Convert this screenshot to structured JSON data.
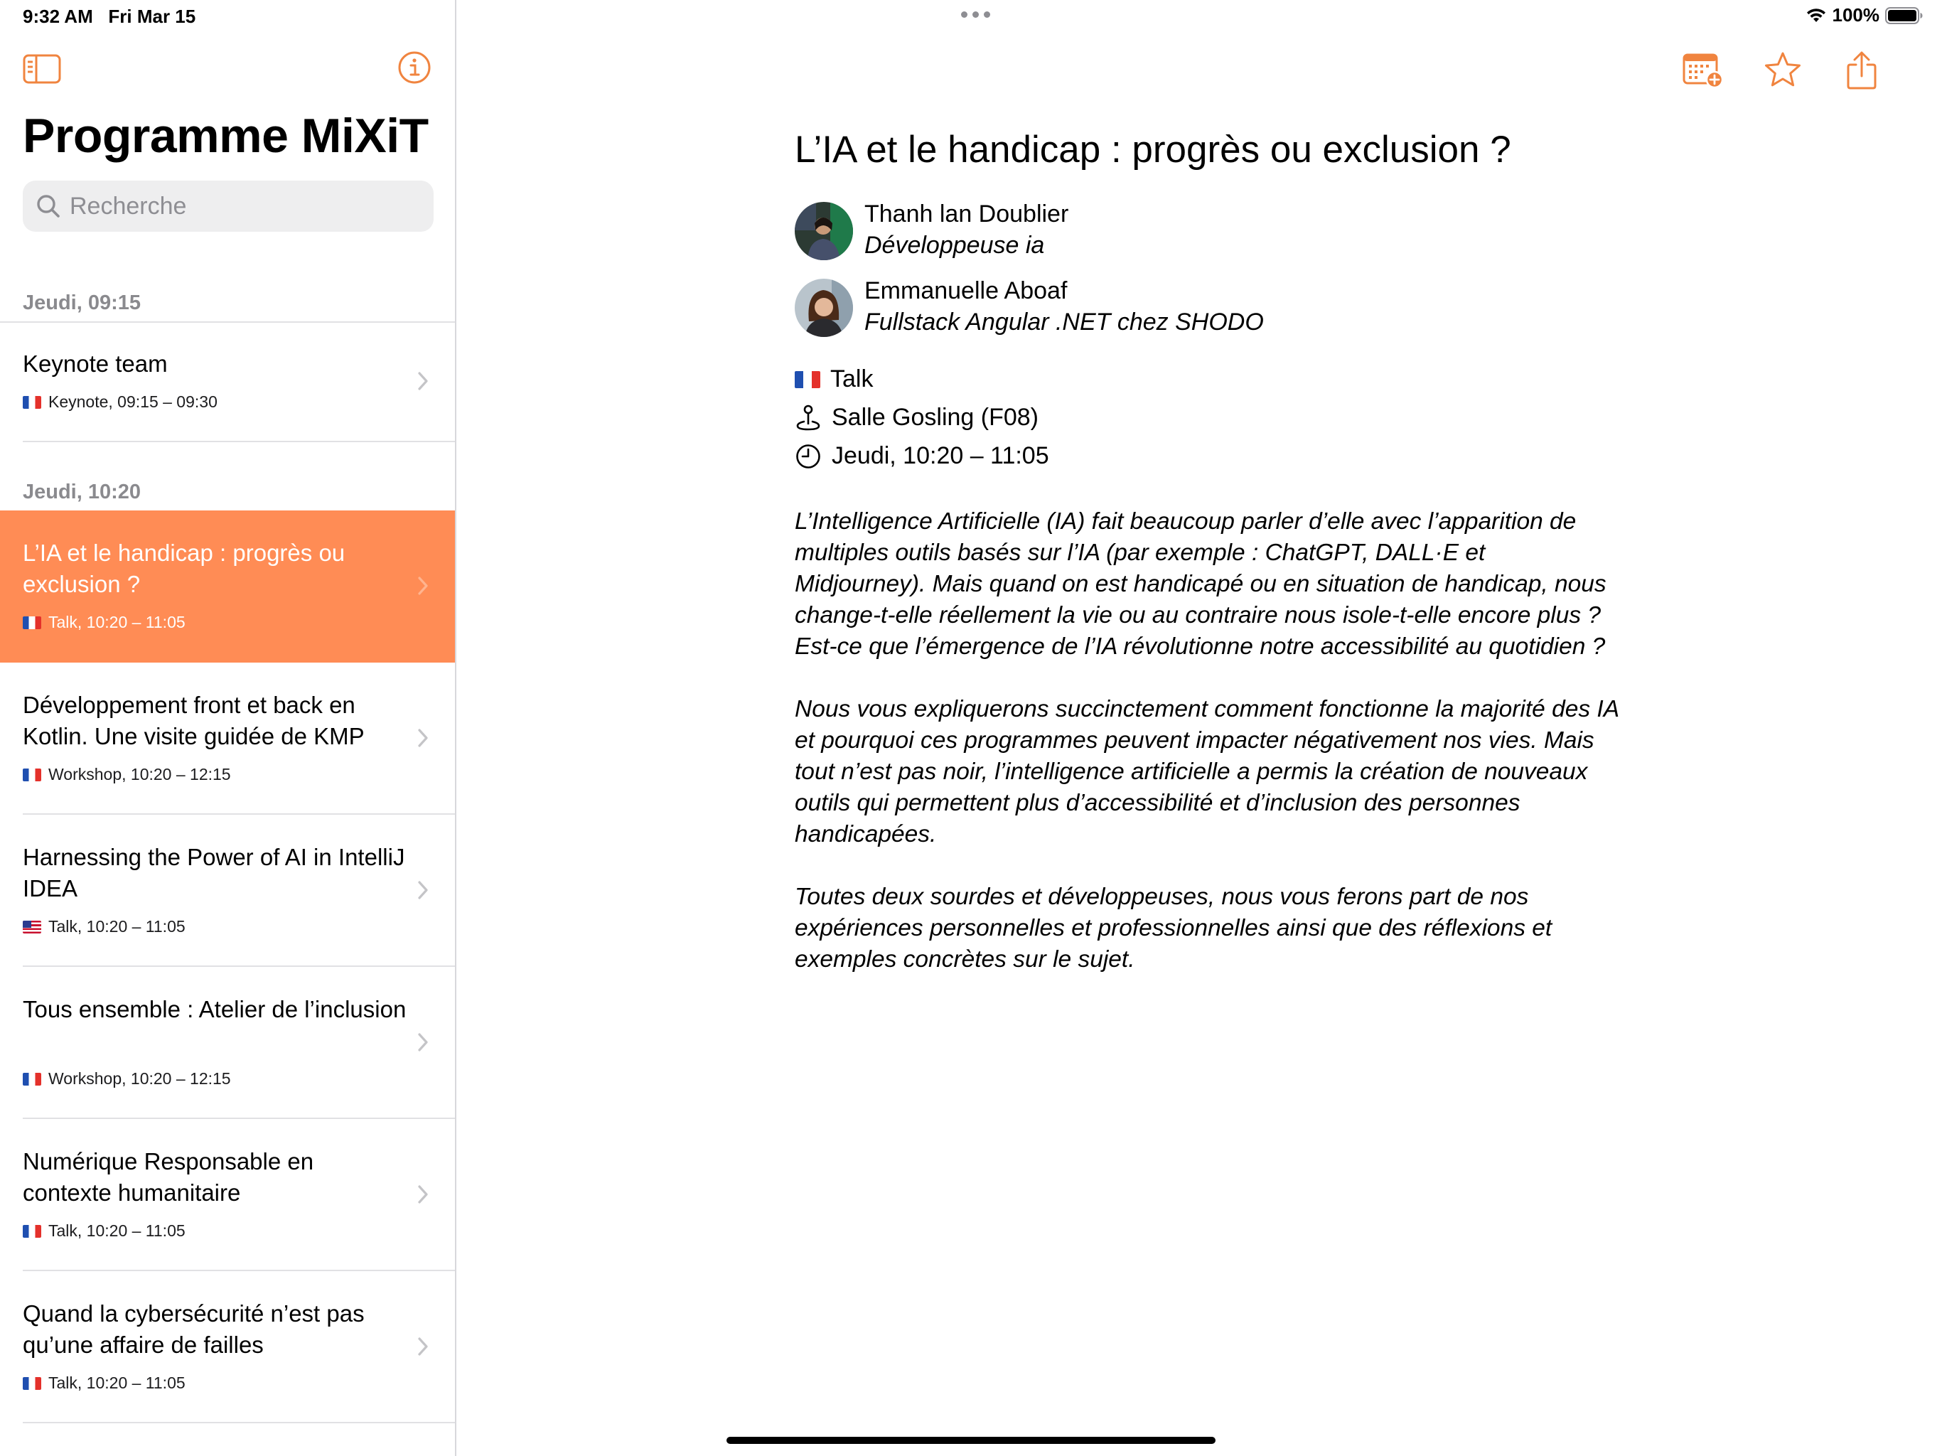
{
  "status_bar": {
    "time_date": "9:32 AM   Fri Mar 15",
    "battery_percent": "100%"
  },
  "colors": {
    "accent": "#f0843f",
    "selected_row": "#ff8c55",
    "section_header": "#8a8a8e"
  },
  "sidebar": {
    "title": "Programme MiXiT",
    "search_placeholder": "Recherche",
    "icons": [
      "sidebar-toggle-icon",
      "info-icon"
    ],
    "sections": [
      {
        "header": "Jeudi, 09:15",
        "items": [
          {
            "title": "Keynote team",
            "meta": "Keynote, 09:15 – 09:30",
            "flag": "fr"
          }
        ]
      },
      {
        "header": "Jeudi, 10:20",
        "items": [
          {
            "title": "L’IA et le handicap : progrès ou exclusion ?",
            "meta": "Talk, 10:20 – 11:05",
            "flag": "fr",
            "selected": true
          },
          {
            "title": "Développement front et back en Kotlin. Une visite guidée de KMP",
            "meta": "Workshop, 10:20 – 12:15",
            "flag": "fr"
          },
          {
            "title": "Harnessing the Power of AI in IntelliJ IDEA",
            "meta": "Talk, 10:20 – 11:05",
            "flag": "us"
          },
          {
            "title": "Tous ensemble : Atelier de l’inclusion",
            "meta": "Workshop, 10:20 – 12:15",
            "flag": "fr"
          },
          {
            "title": "Numérique Responsable en contexte humanitaire",
            "meta": "Talk, 10:20 – 11:05",
            "flag": "fr"
          },
          {
            "title": "Quand la cybersécurité n’est pas qu’une affaire de failles",
            "meta": "Talk, 10:20 – 11:05",
            "flag": "fr"
          }
        ]
      }
    ]
  },
  "detail": {
    "toolbar_icons": [
      "add-to-calendar-icon",
      "star-icon",
      "share-icon"
    ],
    "title": "L’IA et le handicap : progrès ou exclusion ?",
    "speakers": [
      {
        "name": "Thanh lan Doublier",
        "role": "Développeuse ia"
      },
      {
        "name": "Emmanuelle Aboaf",
        "role": "Fullstack Angular .NET chez SHODO"
      }
    ],
    "format": "Talk",
    "room": "Salle Gosling (F08)",
    "time": "Jeudi, 10:20 – 11:05",
    "description": [
      "L’Intelligence Artificielle (IA) fait beaucoup parler d’elle avec l’apparition de multiples outils basés sur l’IA (par exemple : ChatGPT, DALL·E et Midjourney). Mais quand on est handicapé ou en situation de handicap, nous change-t-elle réellement la vie ou au contraire nous isole-t-elle encore plus ? Est-ce que l’émergence de l’IA révolutionne notre accessibilité au quotidien ?",
      "Nous vous expliquerons succinctement comment fonctionne la majorité des IA et pourquoi ces programmes peuvent impacter négativement nos vies. Mais tout n’est pas noir, l’intelligence artificielle a permis la création de nouveaux outils qui permettent plus d’accessibilité et d’inclusion des personnes handicapées.",
      "Toutes deux sourdes et développeuses, nous vous ferons part de nos expériences personnelles et professionnelles ainsi que des réflexions et exemples concrètes sur le sujet."
    ]
  }
}
